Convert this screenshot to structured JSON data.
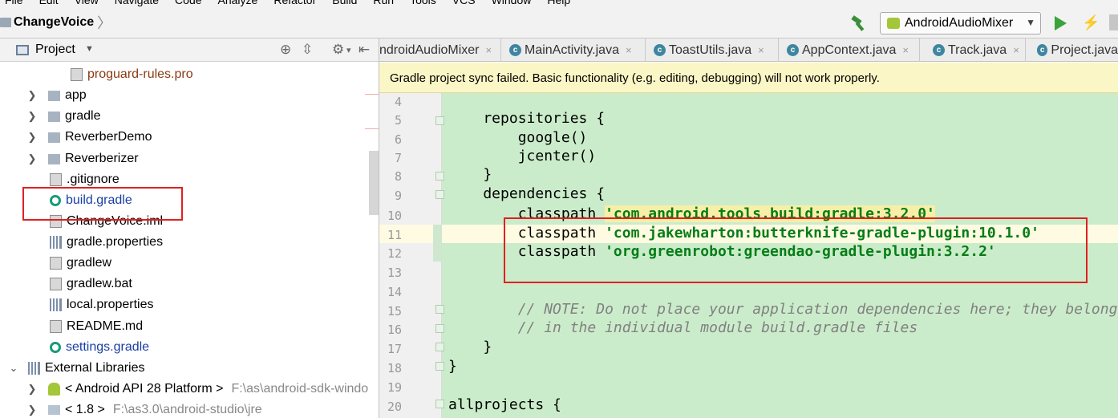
{
  "menu": [
    "File",
    "Edit",
    "View",
    "Navigate",
    "Code",
    "Analyze",
    "Refactor",
    "Build",
    "Run",
    "Tools",
    "VCS",
    "Window",
    "Help"
  ],
  "breadcrumb": {
    "project": "ChangeVoice"
  },
  "toolbar": {
    "run_config": "AndroidAudioMixer"
  },
  "project_panel": {
    "title": "Project",
    "tree": [
      {
        "label": "proguard-rules.pro",
        "kind": "file",
        "color": "brown"
      },
      {
        "label": "app",
        "kind": "module",
        "expandable": true
      },
      {
        "label": "gradle",
        "kind": "folder",
        "expandable": true
      },
      {
        "label": "ReverberDemo",
        "kind": "module",
        "expandable": true
      },
      {
        "label": "Reverberizer",
        "kind": "module",
        "expandable": true
      },
      {
        "label": ".gitignore",
        "kind": "file"
      },
      {
        "label": "build.gradle",
        "kind": "gradle",
        "color": "blue",
        "highlighted": true
      },
      {
        "label": "ChangeVoice.iml",
        "kind": "file"
      },
      {
        "label": "gradle.properties",
        "kind": "props"
      },
      {
        "label": "gradlew",
        "kind": "file"
      },
      {
        "label": "gradlew.bat",
        "kind": "file"
      },
      {
        "label": "local.properties",
        "kind": "props"
      },
      {
        "label": "README.md",
        "kind": "file"
      },
      {
        "label": "settings.gradle",
        "kind": "gradle",
        "color": "blue"
      },
      {
        "label": "External Libraries",
        "kind": "libs",
        "expanded": true
      },
      {
        "label": "< Android API 28 Platform >",
        "hint": "F:\\as\\android-sdk-windo",
        "kind": "android",
        "expandable": true
      },
      {
        "label": "< 1.8 >",
        "hint": "F:\\as3.0\\android-studio\\jre",
        "kind": "jdk",
        "expandable": true
      }
    ]
  },
  "tabs": [
    {
      "label": "ndroidAudioMixer",
      "closable": true
    },
    {
      "label": "MainActivity.java",
      "closable": true
    },
    {
      "label": "ToastUtils.java",
      "closable": true
    },
    {
      "label": "AppContext.java",
      "closable": true
    },
    {
      "label": "Track.java",
      "closable": true
    },
    {
      "label": "Project.java",
      "closable": false
    }
  ],
  "banner": "Gradle project sync failed. Basic functionality (e.g. editing, debugging) will not work properly.",
  "editor": {
    "lines": [
      {
        "n": "4",
        "text": ""
      },
      {
        "n": "5",
        "text": "    repositories {"
      },
      {
        "n": "6",
        "text": "        google()"
      },
      {
        "n": "7",
        "text": "        jcenter()"
      },
      {
        "n": "8",
        "text": "    }"
      },
      {
        "n": "9",
        "text": "    dependencies {"
      },
      {
        "n": "10",
        "kw": "        classpath ",
        "str": "'com.android.tools.build:gradle:3.2.0'"
      },
      {
        "n": "11",
        "kw": "        classpath ",
        "str": "'com.jakewharton:butterknife-gradle-plugin:10.1.0'"
      },
      {
        "n": "12",
        "kw": "        classpath ",
        "str": "'org.greenrobot:greendao-gradle-plugin:3.2.2'"
      },
      {
        "n": "13",
        "text": ""
      },
      {
        "n": "14",
        "text": ""
      },
      {
        "n": "15",
        "cmt": "        // NOTE: Do not place your application dependencies here; they belong"
      },
      {
        "n": "16",
        "cmt": "        // in the individual module build.gradle files"
      },
      {
        "n": "17",
        "text": "    }"
      },
      {
        "n": "18",
        "text": "}"
      },
      {
        "n": "19",
        "text": ""
      },
      {
        "n": "20",
        "text": "allprojects {"
      }
    ]
  }
}
